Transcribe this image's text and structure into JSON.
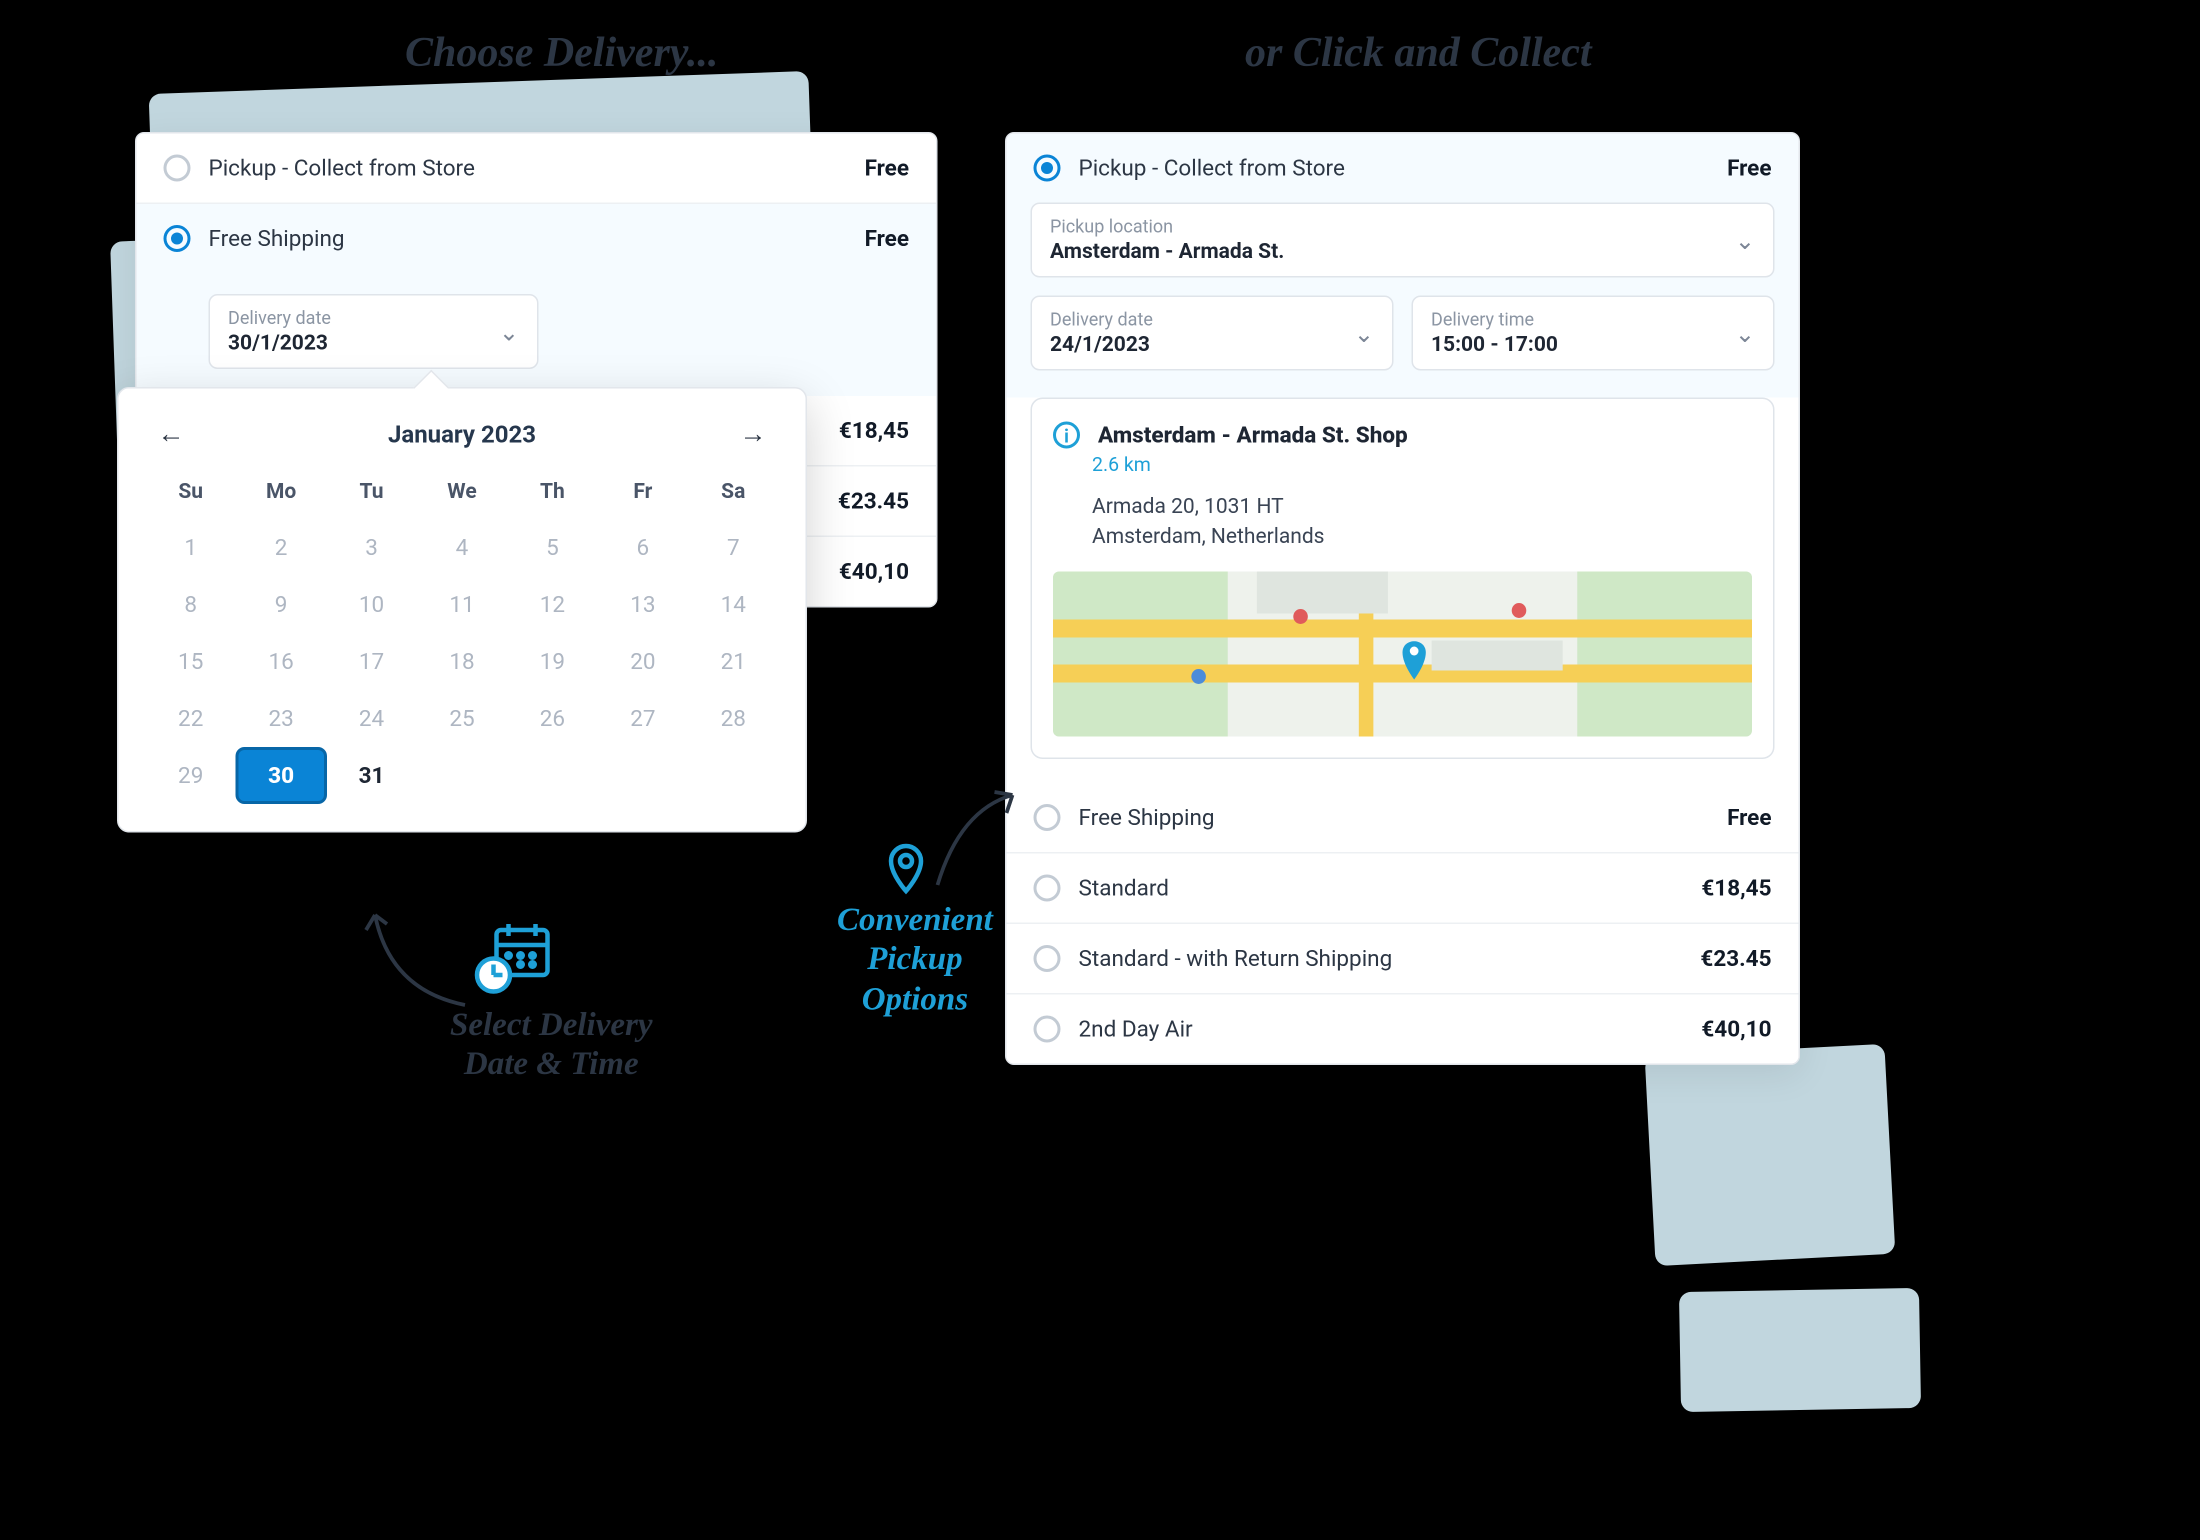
{
  "annotations": {
    "choose_delivery": "Choose Delivery...",
    "or_click_collect": "or Click and Collect",
    "select_date_time_l1": "Select Delivery",
    "select_date_time_l2": "Date & Time",
    "convenient_l1": "Convenient",
    "convenient_l2": "Pickup",
    "convenient_l3": "Options"
  },
  "left_panel": {
    "options": [
      {
        "label": "Pickup - Collect from Store",
        "price": "Free",
        "selected": false
      },
      {
        "label": "Free Shipping",
        "price": "Free",
        "selected": true
      }
    ],
    "delivery_date_label": "Delivery date",
    "delivery_date_value": "30/1/2023",
    "more_prices": [
      "€18,45",
      "€23.45",
      "€40,10"
    ]
  },
  "calendar": {
    "title": "January 2023",
    "dow": [
      "Su",
      "Mo",
      "Tu",
      "We",
      "Th",
      "Fr",
      "Sa"
    ],
    "days": [
      1,
      2,
      3,
      4,
      5,
      6,
      7,
      8,
      9,
      10,
      11,
      12,
      13,
      14,
      15,
      16,
      17,
      18,
      19,
      20,
      21,
      22,
      23,
      24,
      25,
      26,
      27,
      28,
      29,
      30,
      31
    ],
    "selected": 30,
    "current_month_last": 31
  },
  "right_panel": {
    "pickup_option": {
      "label": "Pickup - Collect from Store",
      "price": "Free"
    },
    "pickup_location_label": "Pickup location",
    "pickup_location_value": "Amsterdam - Armada St.",
    "delivery_date_label": "Delivery date",
    "delivery_date_value": "24/1/2023",
    "delivery_time_label": "Delivery time",
    "delivery_time_value": "15:00 - 17:00",
    "store": {
      "name": "Amsterdam - Armada St. Shop",
      "distance": "2.6 km",
      "address_l1": "Armada 20, 1031 HT",
      "address_l2": "Amsterdam, Netherlands"
    },
    "options": [
      {
        "label": "Free Shipping",
        "price": "Free"
      },
      {
        "label": "Standard",
        "price": "€18,45"
      },
      {
        "label": "Standard - with Return Shipping",
        "price": "€23.45"
      },
      {
        "label": "2nd Day Air",
        "price": "€40,10"
      }
    ]
  }
}
